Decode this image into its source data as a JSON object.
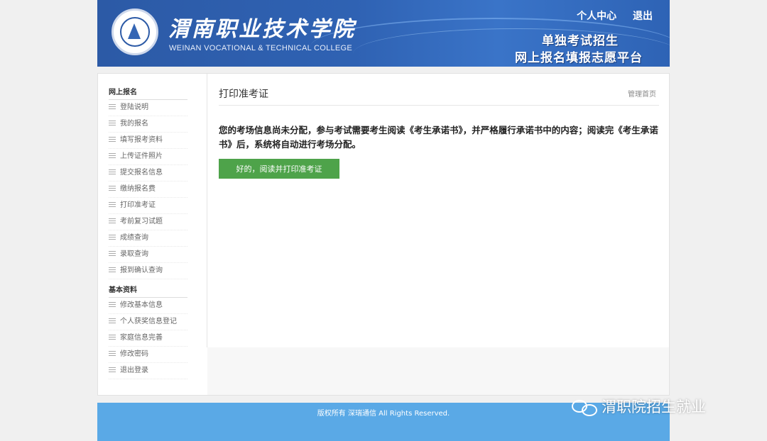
{
  "header": {
    "college_cn": "渭南职业技术学院",
    "college_en": "WEINAN VOCATIONAL & TECHNICAL COLLEGE",
    "links": {
      "personal_center": "个人中心",
      "logout": "退出"
    },
    "platform_line1": "单独考试招生",
    "platform_line2": "网上报名填报志愿平台"
  },
  "sidebar": {
    "section1_title": "网上报名",
    "section1_items": [
      "登陆说明",
      "我的报名",
      "填写报考资料",
      "上传证件照片",
      "提交报名信息",
      "缴纳报名费",
      "打印准考证",
      "考前复习试题",
      "成绩查询",
      "录取查询",
      "报到确认查询"
    ],
    "section2_title": "基本资料",
    "section2_items": [
      "修改基本信息",
      "个人获奖信息登记",
      "家庭信息完善",
      "修改密码",
      "退出登录"
    ]
  },
  "main": {
    "title": "打印准考证",
    "manage_link": "管理首页",
    "notice": "您的考场信息尚未分配，参与考试需要考生阅读《考生承诺书》，并严格履行承诺书中的内容；阅读完《考生承诺书》后，系统将自动进行考场分配。",
    "button_label": "好的，阅读并打印准考证"
  },
  "footer": {
    "copyright": "版权所有 深瑞通信 All Rights Reserved."
  },
  "watermark": {
    "text": "渭职院招生就业"
  },
  "colors": {
    "header_blue": "#2f62b3",
    "button_green": "#4ea34a",
    "footer_blue": "#5aa9e6"
  },
  "icons": {
    "logo": "college-seal-logo",
    "menu_item": "list-icon",
    "watermark": "wechat-icon"
  }
}
